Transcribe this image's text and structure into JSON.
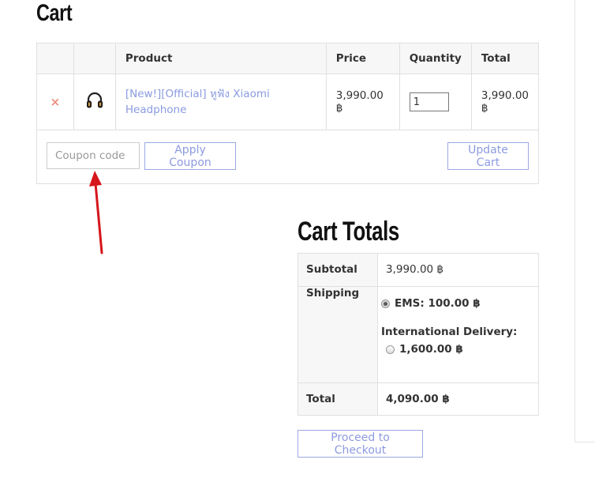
{
  "page": {
    "title": "Cart"
  },
  "cart_table": {
    "headers": {
      "product": "Product",
      "price": "Price",
      "quantity": "Quantity",
      "total": "Total"
    },
    "items": [
      {
        "remove_symbol": "×",
        "thumbnail_icon": "headphone-icon",
        "product_name": "[New!][Official] หูฟัง Xiaomi Headphone",
        "price": "3,990.00 ฿",
        "quantity": "1",
        "total": "3,990.00 ฿"
      }
    ],
    "coupon_placeholder": "Coupon code",
    "apply_coupon_label": "Apply Coupon",
    "update_cart_label": "Update Cart"
  },
  "cart_totals": {
    "title": "Cart Totals",
    "subtotal_label": "Subtotal",
    "subtotal_value": "3,990.00 ฿",
    "shipping_label": "Shipping",
    "shipping_options": [
      {
        "label": "EMS: 100.00 ฿",
        "selected": true
      },
      {
        "heading": "International Delivery:",
        "label": "1,600.00 ฿",
        "selected": false
      }
    ],
    "total_label": "Total",
    "total_value": "4,090.00 ฿",
    "checkout_label": "Proceed to Checkout"
  },
  "colors": {
    "link": "#8a9be0",
    "button_border": "#9aa8e3",
    "remove": "#e8907e",
    "annotation_arrow": "#d6161b"
  }
}
